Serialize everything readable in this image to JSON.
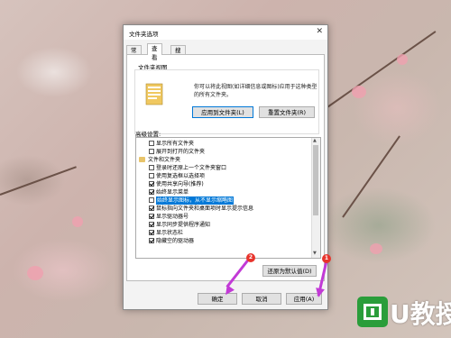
{
  "dialog": {
    "title": "文件夹选项",
    "close_glyph": "✕",
    "tabs": [
      "常规",
      "查看",
      "搜索"
    ],
    "active_tab": "查看"
  },
  "folder_views": {
    "group_label": "文件夹视图",
    "description": "你可以将此视图(如详细信息或图标)应用于这种类型的所有文件夹。",
    "apply_button": "应用到文件夹(L)",
    "reset_button": "重置文件夹(R)"
  },
  "advanced": {
    "group_label": "高级设置:",
    "items": [
      {
        "label": "显示所有文件夹",
        "checked": false,
        "type": "checkbox"
      },
      {
        "label": "展开到打开的文件夹",
        "checked": false,
        "type": "checkbox"
      },
      {
        "label": "文件和文件夹",
        "type": "folder"
      },
      {
        "label": "登录时还原上一个文件夹窗口",
        "checked": false,
        "type": "checkbox"
      },
      {
        "label": "使用复选框以选择项",
        "checked": false,
        "type": "checkbox"
      },
      {
        "label": "使用共享向导(推荐)",
        "checked": true,
        "type": "checkbox"
      },
      {
        "label": "始终显示菜单",
        "checked": true,
        "type": "checkbox"
      },
      {
        "label": "始终显示图标，从不显示缩略图",
        "checked": false,
        "type": "checkbox",
        "selected": true
      },
      {
        "label": "鼠标指向文件夹和桌面项时显示提示信息",
        "checked": true,
        "type": "checkbox"
      },
      {
        "label": "显示驱动器号",
        "checked": true,
        "type": "checkbox"
      },
      {
        "label": "显示同步提供程序通知",
        "checked": true,
        "type": "checkbox"
      },
      {
        "label": "显示状态栏",
        "checked": true,
        "type": "checkbox"
      },
      {
        "label": "隐藏空的驱动器",
        "checked": true,
        "type": "checkbox"
      }
    ],
    "restore_defaults_button": "还原为默认值(D)"
  },
  "footer": {
    "ok_button": "确定",
    "cancel_button": "取消",
    "apply_button": "应用(A)"
  },
  "annotations": {
    "marker_1": "1",
    "marker_2": "2",
    "marker_color": "#e8342c",
    "arrow_color": "#c23ad6"
  },
  "watermark": {
    "text": "U教授"
  }
}
